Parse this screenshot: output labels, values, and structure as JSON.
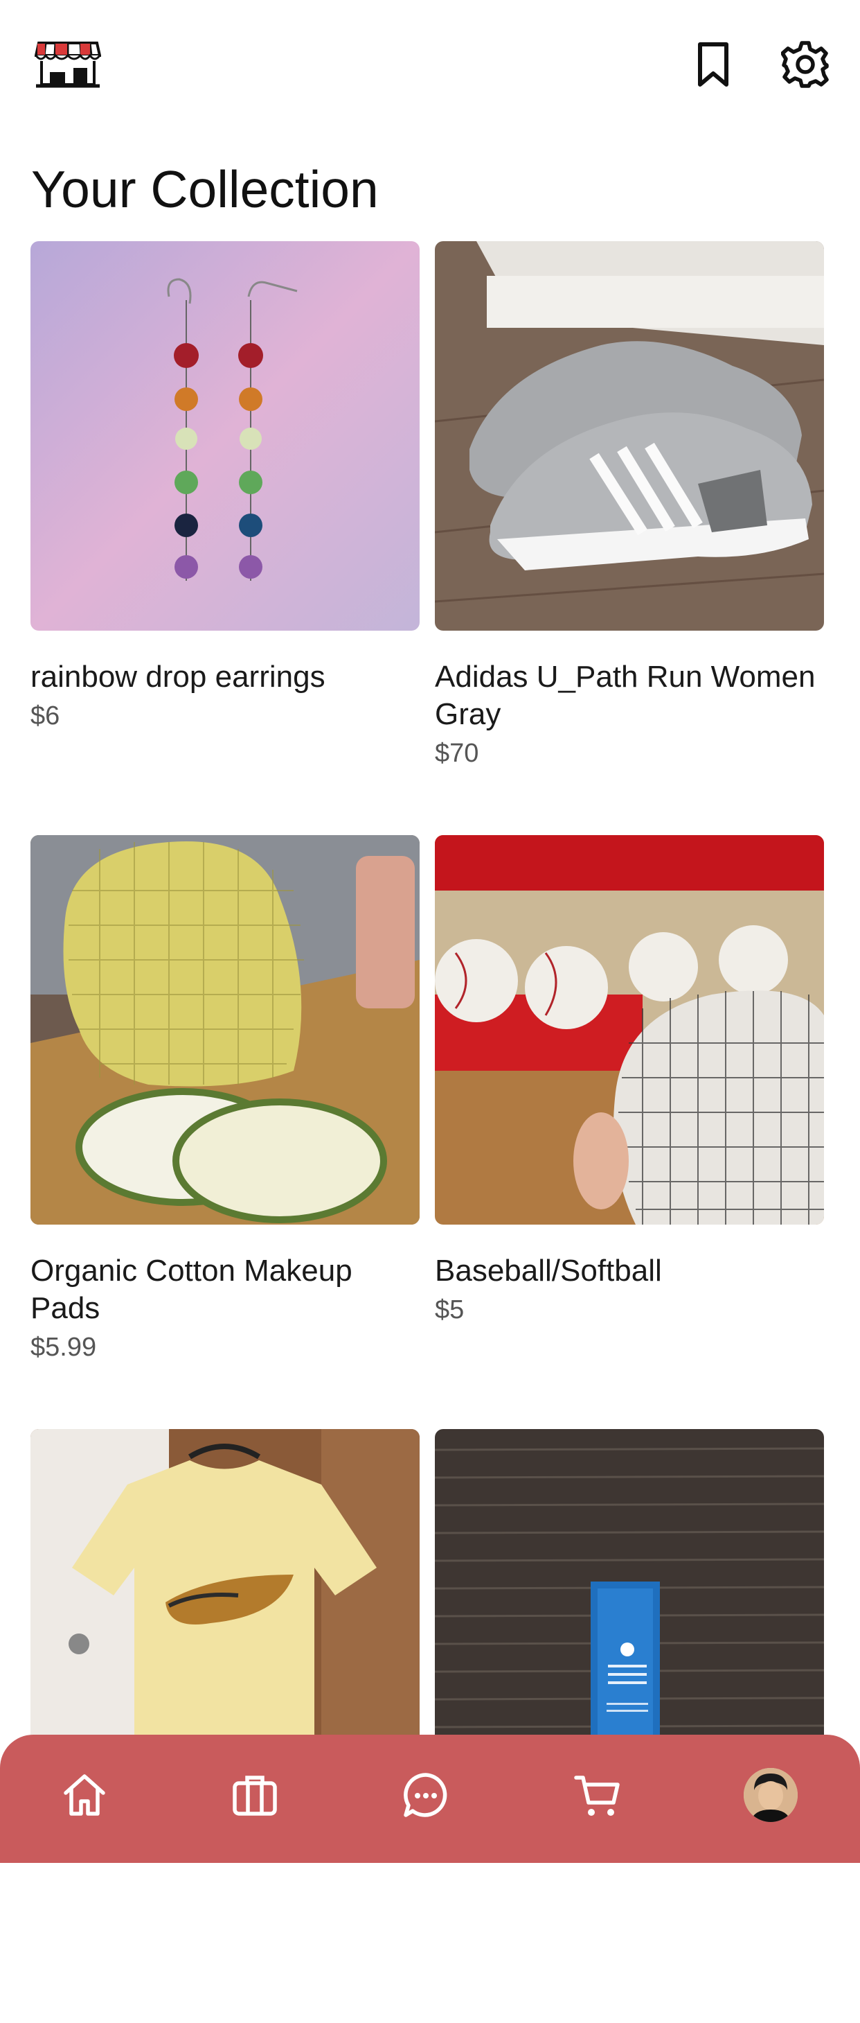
{
  "header": {
    "logo_icon": "storefront-icon",
    "bookmark_icon": "bookmark-icon",
    "settings_icon": "gear-icon"
  },
  "page": {
    "title": "Your Collection"
  },
  "items": [
    {
      "name": "rainbow drop earrings",
      "price": "$6",
      "image": "earrings"
    },
    {
      "name": "Adidas U_Path Run Women Gray",
      "price": "$70",
      "image": "sneakers"
    },
    {
      "name": "Organic Cotton Makeup Pads",
      "price": "$5.99",
      "image": "makeup-pads"
    },
    {
      "name": "Baseball/Softball",
      "price": "$5",
      "image": "baseballs"
    },
    {
      "name": "",
      "price": "",
      "image": "tshirt"
    },
    {
      "name": "",
      "price": "",
      "image": "serum-box"
    }
  ],
  "bottom_nav": {
    "items": [
      "home-icon",
      "briefcase-icon",
      "chat-icon",
      "cart-icon",
      "avatar"
    ],
    "color": "#c95b5c"
  }
}
